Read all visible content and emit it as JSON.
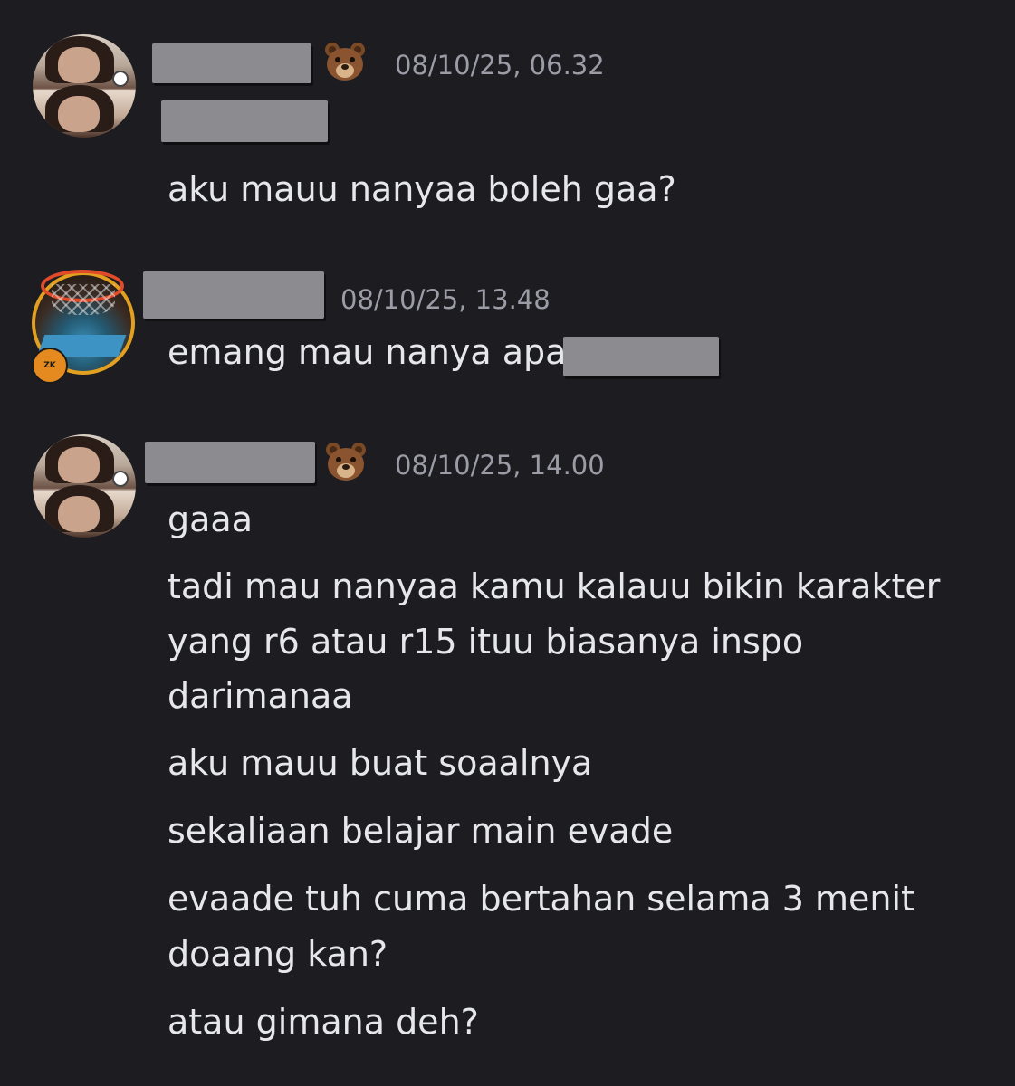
{
  "messages": [
    {
      "avatar": "user-photo-avatar",
      "username_redacted": true,
      "emoji": "bear-face",
      "timestamp": "08/10/25, 06.32",
      "lines": [
        "aku mauu nanyaa boleh gaa?"
      ]
    },
    {
      "avatar": "basketball-hoop-avatar",
      "username_redacted": true,
      "timestamp": "08/10/25, 13.48",
      "lines": [
        "emang mau nanya apa"
      ],
      "inline_redaction": true
    },
    {
      "avatar": "user-photo-avatar",
      "username_redacted": true,
      "emoji": "bear-face",
      "timestamp": "08/10/25, 14.00",
      "lines": [
        "gaaa",
        "tadi mau nanyaa kamu kalauu bikin karakter",
        "yang r6 atau r15 ituu biasanya inspo",
        "darimanaa",
        "aku mauu buat soaalnya",
        "sekaliaan belajar main evade",
        "evaade tuh cuma bertahan selama 3 menit",
        "doaang kan?",
        "atau gimana deh?"
      ]
    }
  ],
  "colors": {
    "background": "#1c1c21",
    "text": "#e6e7ec",
    "timestamp": "#9b9ca6",
    "redaction": "#8c8c90",
    "hoop_ring": "#e3a020"
  }
}
